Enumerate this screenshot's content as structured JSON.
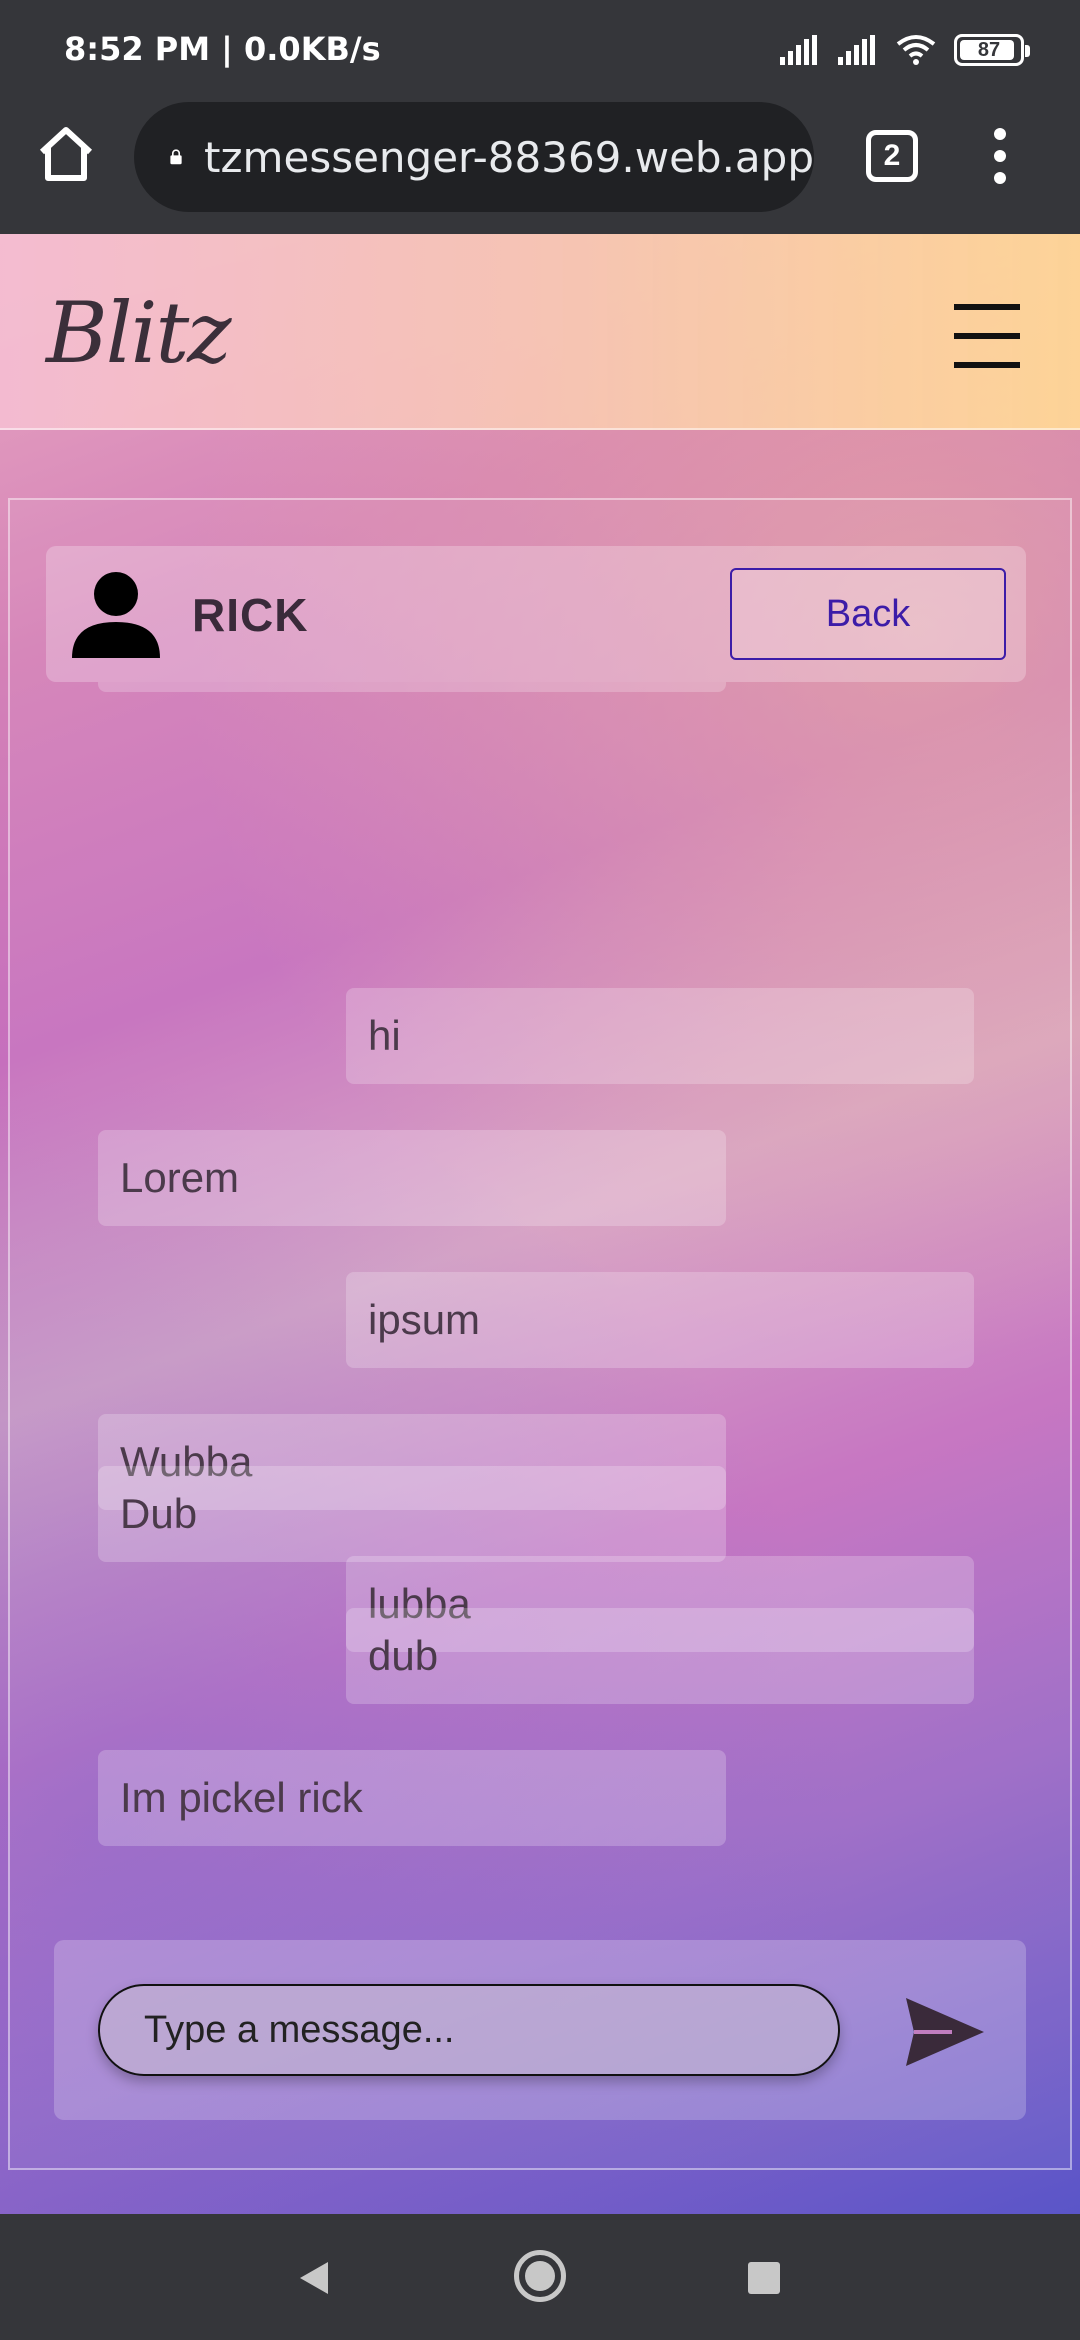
{
  "status_bar": {
    "time_speed": "8:52 PM | 0.0KB/s",
    "battery": "87",
    "icons": [
      "signal-icon",
      "signal-icon",
      "wifi-icon",
      "battery-icon"
    ]
  },
  "browser": {
    "url": "tzmessenger-88369.web.app",
    "tab_count": "2"
  },
  "app": {
    "logo": "Blitz"
  },
  "chat": {
    "contact_name": "RICK",
    "back_label": "Back",
    "messages": [
      {
        "text": "hi",
        "side": "sent"
      },
      {
        "text": "Lorem",
        "side": "received"
      },
      {
        "text": "ipsum",
        "side": "sent"
      },
      {
        "text": "Wubba",
        "side": "received"
      },
      {
        "text": "lubba",
        "side": "sent"
      },
      {
        "text": "Dub",
        "side": "received"
      },
      {
        "text": "dub",
        "side": "sent"
      },
      {
        "text": "Im pickel rick",
        "side": "received"
      }
    ],
    "input_placeholder": "Type a message..."
  },
  "colors": {
    "back_accent": "#3c1ca8",
    "chrome_bg": "#35363a"
  }
}
